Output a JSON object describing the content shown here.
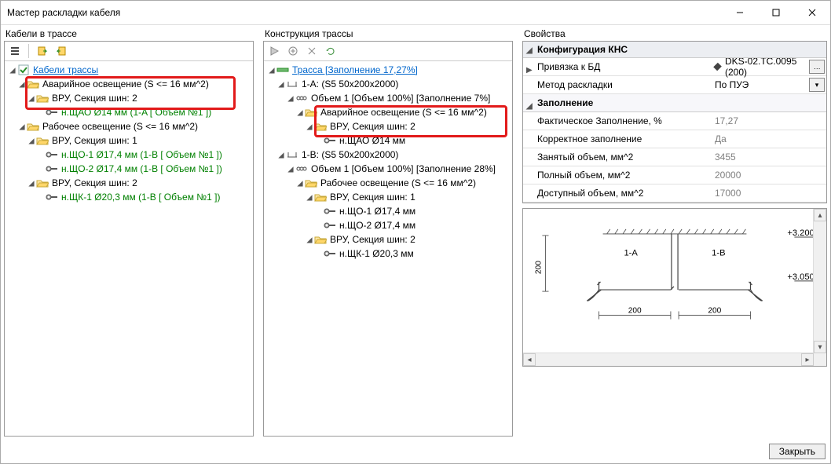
{
  "window": {
    "title": "Мастер раскладки кабеля"
  },
  "panels": {
    "left_label": "Кабели в трассе",
    "mid_label": "Конструкция трассы",
    "right_label": "Свойства"
  },
  "left_tree": {
    "root": "Кабели трассы",
    "emergency": "Аварийное освещение (S <= 16 мм^2)",
    "vru2": "ВРУ, Секция шин: 2",
    "shchao": "н.ЩАО  Ø14 мм (1-A [ Объем №1 ])",
    "rabochee": "Рабочее освещение (S <= 16 мм^2)",
    "vru1": "ВРУ, Секция шин: 1",
    "shcho1": "н.ЩО-1  Ø17,4 мм (1-B [ Объем №1 ])",
    "shcho2": "н.ЩО-2  Ø17,4 мм (1-B [ Объем №1 ])",
    "vru2b": "ВРУ, Секция шин: 2",
    "shchk1": "н.ЩК-1  Ø20,3 мм (1-B [ Объем №1 ])"
  },
  "mid_tree": {
    "root": "Трасса [Заполнение 17,27%]",
    "sec1a": "1-A: (S5 50x200x2000)",
    "vol1a": "Объем 1 [Объем 100%] [Заполнение 7%]",
    "emergency": "Аварийное освещение (S <= 16 мм^2)",
    "vru2": "ВРУ, Секция шин: 2",
    "shchao": "н.ЩАО  Ø14 мм",
    "sec1b": "1-B: (S5 50x200x2000)",
    "vol1b": "Объем 1 [Объем 100%] [Заполнение 28%]",
    "rabochee": "Рабочее освещение (S <= 16 мм^2)",
    "vru1": "ВРУ, Секция шин: 1",
    "shcho1": "н.ЩО-1  Ø17,4 мм",
    "shcho2": "н.ЩО-2  Ø17,4 мм",
    "vru2b": "ВРУ, Секция шин: 2",
    "shchk1": "н.ЩК-1  Ø20,3 мм"
  },
  "props": {
    "cat1": "Конфигурация КНС",
    "binding_key": "Привязка к БД",
    "binding_val": "DKS-02.TC.0095 (200)",
    "method_key": "Метод раскладки",
    "method_val": "По ПУЭ",
    "cat2": "Заполнение",
    "fill_pct_key": "Фактическое Заполнение, %",
    "fill_pct_val": "17,27",
    "correct_key": "Корректное заполнение",
    "correct_val": "Да",
    "busy_key": "Занятый объем, мм^2",
    "busy_val": "3455",
    "full_key": "Полный объем, мм^2",
    "full_val": "20000",
    "avail_key": "Доступный объем, мм^2",
    "avail_val": "17000"
  },
  "diagram": {
    "label_a": "1-A",
    "label_b": "1-B",
    "d200a": "200",
    "d200b": "200",
    "d_v": "200",
    "elev_top": "+3.200",
    "elev_bottom": "+3.050"
  },
  "footer": {
    "close": "Закрыть"
  }
}
